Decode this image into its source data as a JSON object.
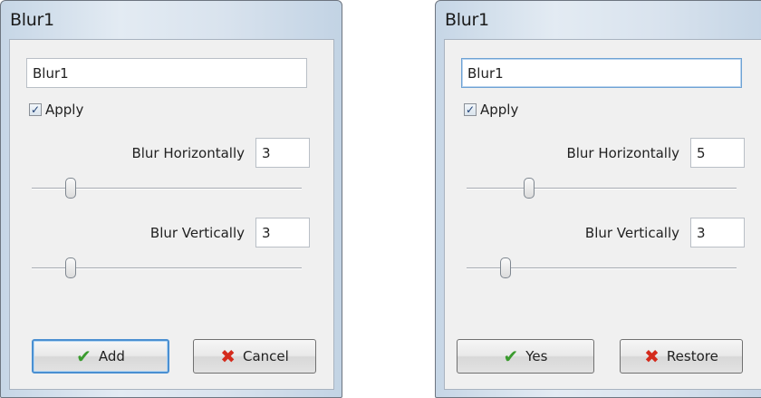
{
  "dialogs": [
    {
      "title": "Blur1",
      "name_value": "Blur1",
      "apply": {
        "label": "Apply",
        "checked": true
      },
      "horizontal": {
        "label": "Blur Horizontally",
        "value": "3",
        "slider_fraction": 0.13
      },
      "vertical": {
        "label": "Blur Vertically",
        "value": "3",
        "slider_fraction": 0.13
      },
      "buttons": {
        "primary": {
          "label": "Add",
          "icon": "check-icon"
        },
        "secondary": {
          "label": "Cancel",
          "icon": "x-icon"
        }
      }
    },
    {
      "title": "Blur1",
      "name_value": "Blur1",
      "apply": {
        "label": "Apply",
        "checked": true
      },
      "horizontal": {
        "label": "Blur Horizontally",
        "value": "5",
        "slider_fraction": 0.22
      },
      "vertical": {
        "label": "Blur Vertically",
        "value": "3",
        "slider_fraction": 0.13
      },
      "buttons": {
        "primary": {
          "label": "Yes",
          "icon": "check-icon"
        },
        "secondary": {
          "label": "Restore",
          "icon": "x-icon"
        }
      }
    }
  ],
  "colors": {
    "check_icon": "#3a9b2e",
    "x_icon": "#d42a1c",
    "default_button_border": "#4a8fd1"
  }
}
